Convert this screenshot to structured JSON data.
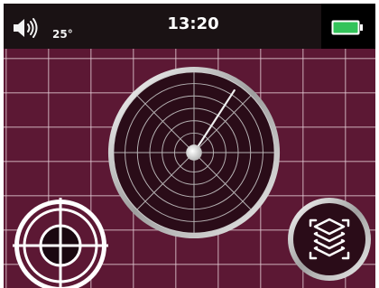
{
  "status_bar": {
    "temperature": "25°",
    "time": "13:20",
    "battery_color": "#33c35a",
    "volume_icon": "speaker-volume-icon"
  },
  "colors": {
    "screen_background": "#5e1a36",
    "status_bar_background": "#1a1214",
    "ring_color": "#e6e6e6"
  },
  "radar": {
    "icon": "radar-icon",
    "needle_heading_deg": 33
  },
  "buttons": {
    "target": {
      "icon": "crosshair-target-icon"
    },
    "layers": {
      "icon": "layers-icon"
    }
  }
}
